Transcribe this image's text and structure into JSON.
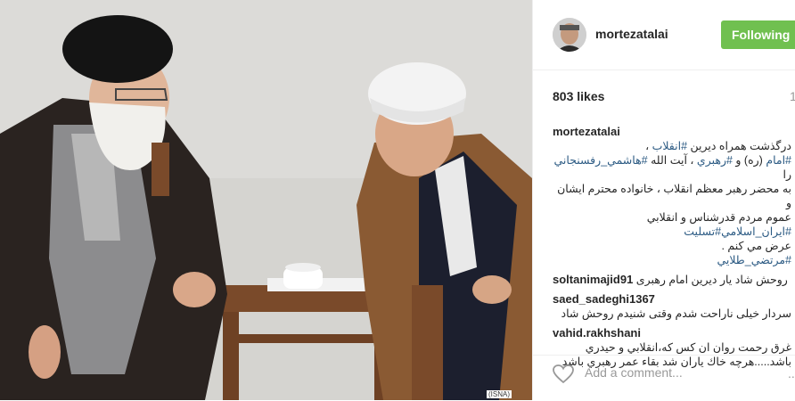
{
  "post": {
    "photo": {
      "watermark": "(ISNA)"
    }
  },
  "header": {
    "username": "mortezatalai",
    "follow_label": "Following"
  },
  "stats": {
    "likes": "803 likes",
    "time": "1"
  },
  "caption": {
    "username": "mortezatalai",
    "lines": [
      {
        "text": "درگذشت همراه ديرين ",
        "tag": "#انقلاب",
        "after": " ،"
      },
      {
        "text": "",
        "tag": "#امام",
        "after": " (ره) و "
      },
      {
        "text": "",
        "tag": "#رهبري",
        "after": " ، آيت الله "
      },
      {
        "text": "",
        "tag": "#هاشمي_رفسنجاني",
        "after": " را"
      },
      {
        "text": "به محضر رهبر معظم انقلاب ، خانواده محترم ايشان و",
        "tag": "",
        "after": ""
      },
      {
        "text": "عموم مردم قدرشناس و انقلابي ",
        "tag": "#ايران_اسلامي",
        "after": ""
      },
      {
        "text": "",
        "tag": "#تسليت",
        "after": ""
      },
      {
        "text": "عرض مي كنم .",
        "tag": "",
        "after": ""
      },
      {
        "text": "",
        "tag": "#مرتضي_طلايي",
        "after": ""
      }
    ]
  },
  "comments": [
    {
      "username": "soltanimajid91",
      "text": "روحش شاد یار دیرین امام رهبری"
    },
    {
      "username": "saed_sadeghi1367",
      "text": "سردار خیلی ناراحت شدم وقتی شنیدم روحش شاد"
    },
    {
      "username": "vahid.rakhshani",
      "text": "غرق رحمت روان ان كس كه،انقلابي و حيدري باشد.....هرچه خاك ياران شد بقاء عمر رهبري باشد"
    }
  ],
  "footer": {
    "add_comment_placeholder": "Add a comment...",
    "more": "..."
  },
  "colors": {
    "follow": "#70c050",
    "hashtag": "#2b5a83"
  }
}
